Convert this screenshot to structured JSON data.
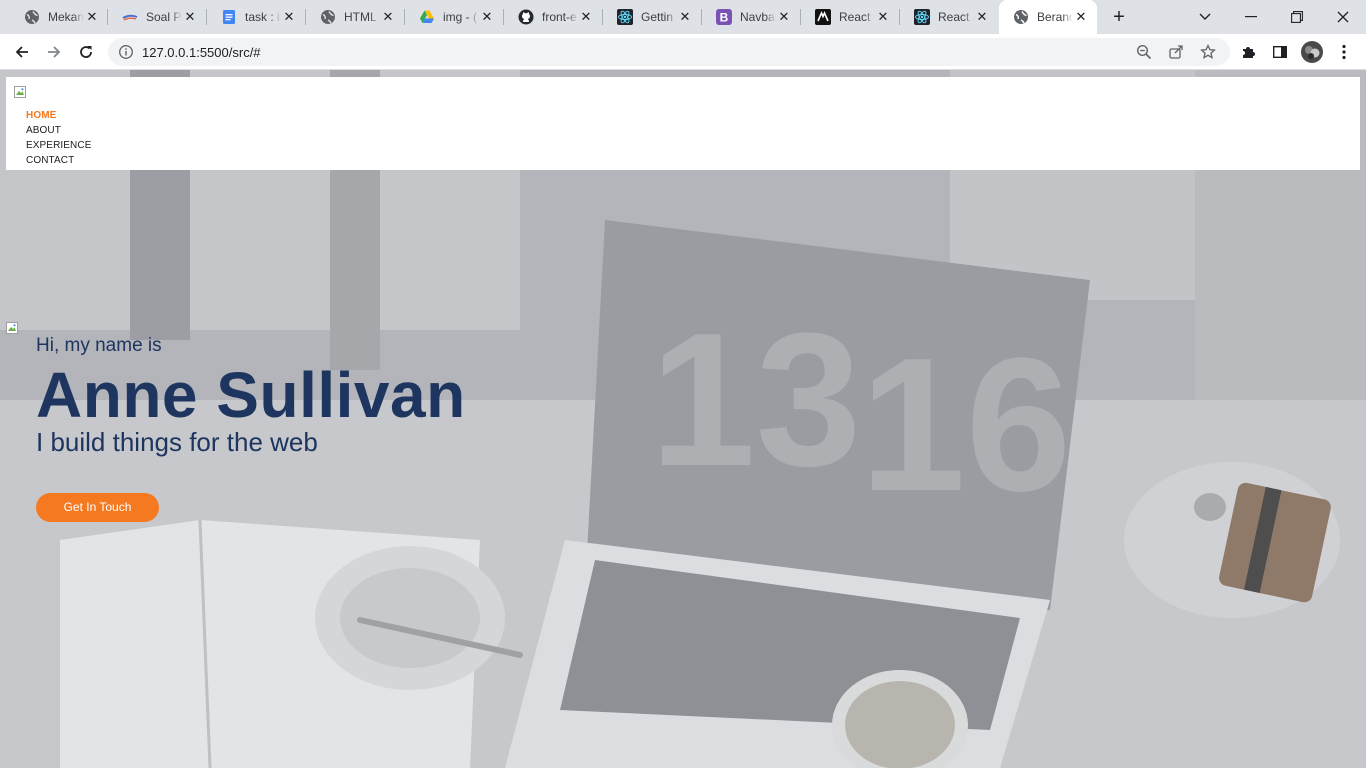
{
  "browser": {
    "tabs": [
      {
        "title": "Mekan",
        "icon": "globe-icon"
      },
      {
        "title": "Soal P",
        "icon": "soal-favicon-icon"
      },
      {
        "title": "task : i",
        "icon": "google-docs-icon"
      },
      {
        "title": "HTML",
        "icon": "globe-icon"
      },
      {
        "title": "img - (",
        "icon": "google-drive-icon"
      },
      {
        "title": "front-e",
        "icon": "github-icon"
      },
      {
        "title": "Gettin",
        "icon": "react-icon"
      },
      {
        "title": "Navba",
        "icon": "bootstrap-icon"
      },
      {
        "title": "React",
        "icon": "react-router-icon"
      },
      {
        "title": "React /",
        "icon": "react-icon"
      },
      {
        "title": "Berand",
        "icon": "globe-icon",
        "active": true
      }
    ],
    "url": "127.0.0.1:5500/src/#"
  },
  "navbar": {
    "items": [
      {
        "label": "HOME",
        "active": true
      },
      {
        "label": "ABOUT"
      },
      {
        "label": "EXPERIENCE"
      },
      {
        "label": "CONTACT"
      }
    ]
  },
  "hero": {
    "greeting": "Hi, my name is",
    "name": "Anne Sullivan",
    "tagline": "I build things for the web",
    "cta_label": "Get In Touch"
  },
  "colors": {
    "accent": "#f47920",
    "heading": "#1e3560",
    "tab_strip": "#dee1e6"
  }
}
